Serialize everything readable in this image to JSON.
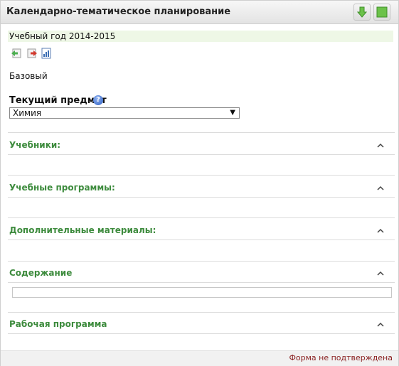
{
  "header": {
    "title": "Календарно-тематическое планирование"
  },
  "year": {
    "label": "Учебный год 2014-2015"
  },
  "icons": [
    "arrow-back-icon",
    "arrow-forward-icon",
    "report-icon"
  ],
  "level": "Базовый",
  "subject": {
    "label": "Текущий предмет",
    "value": "Химия"
  },
  "sections": [
    {
      "title": "Учебники:"
    },
    {
      "title": "Учебные программы:"
    },
    {
      "title": "Дополнительные материалы:"
    },
    {
      "title": "Содержание"
    },
    {
      "title": "Рабочая программа"
    }
  ],
  "footer": {
    "status": "Форма не подтверждена"
  },
  "colors": {
    "section_title": "#3d8b3d",
    "year_bar": "#eef7e6",
    "status": "#8b2323"
  }
}
